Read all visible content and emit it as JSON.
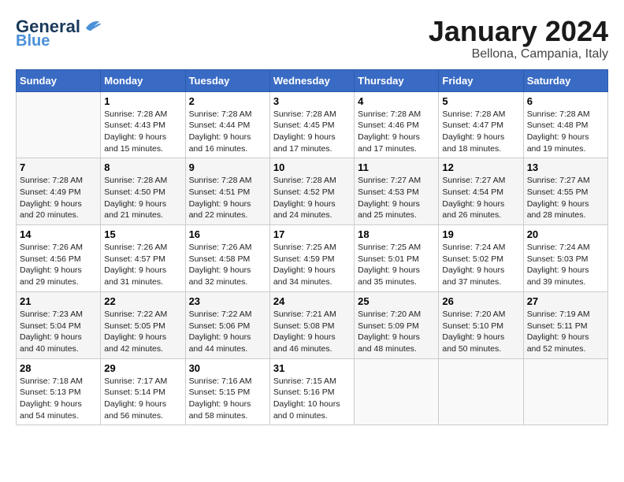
{
  "header": {
    "logo_general": "General",
    "logo_blue": "Blue",
    "month": "January 2024",
    "location": "Bellona, Campania, Italy"
  },
  "weekdays": [
    "Sunday",
    "Monday",
    "Tuesday",
    "Wednesday",
    "Thursday",
    "Friday",
    "Saturday"
  ],
  "weeks": [
    [
      {
        "day": "",
        "sunrise": "",
        "sunset": "",
        "daylight": ""
      },
      {
        "day": "1",
        "sunrise": "Sunrise: 7:28 AM",
        "sunset": "Sunset: 4:43 PM",
        "daylight": "Daylight: 9 hours and 15 minutes."
      },
      {
        "day": "2",
        "sunrise": "Sunrise: 7:28 AM",
        "sunset": "Sunset: 4:44 PM",
        "daylight": "Daylight: 9 hours and 16 minutes."
      },
      {
        "day": "3",
        "sunrise": "Sunrise: 7:28 AM",
        "sunset": "Sunset: 4:45 PM",
        "daylight": "Daylight: 9 hours and 17 minutes."
      },
      {
        "day": "4",
        "sunrise": "Sunrise: 7:28 AM",
        "sunset": "Sunset: 4:46 PM",
        "daylight": "Daylight: 9 hours and 17 minutes."
      },
      {
        "day": "5",
        "sunrise": "Sunrise: 7:28 AM",
        "sunset": "Sunset: 4:47 PM",
        "daylight": "Daylight: 9 hours and 18 minutes."
      },
      {
        "day": "6",
        "sunrise": "Sunrise: 7:28 AM",
        "sunset": "Sunset: 4:48 PM",
        "daylight": "Daylight: 9 hours and 19 minutes."
      }
    ],
    [
      {
        "day": "7",
        "sunrise": "Sunrise: 7:28 AM",
        "sunset": "Sunset: 4:49 PM",
        "daylight": "Daylight: 9 hours and 20 minutes."
      },
      {
        "day": "8",
        "sunrise": "Sunrise: 7:28 AM",
        "sunset": "Sunset: 4:50 PM",
        "daylight": "Daylight: 9 hours and 21 minutes."
      },
      {
        "day": "9",
        "sunrise": "Sunrise: 7:28 AM",
        "sunset": "Sunset: 4:51 PM",
        "daylight": "Daylight: 9 hours and 22 minutes."
      },
      {
        "day": "10",
        "sunrise": "Sunrise: 7:28 AM",
        "sunset": "Sunset: 4:52 PM",
        "daylight": "Daylight: 9 hours and 24 minutes."
      },
      {
        "day": "11",
        "sunrise": "Sunrise: 7:27 AM",
        "sunset": "Sunset: 4:53 PM",
        "daylight": "Daylight: 9 hours and 25 minutes."
      },
      {
        "day": "12",
        "sunrise": "Sunrise: 7:27 AM",
        "sunset": "Sunset: 4:54 PM",
        "daylight": "Daylight: 9 hours and 26 minutes."
      },
      {
        "day": "13",
        "sunrise": "Sunrise: 7:27 AM",
        "sunset": "Sunset: 4:55 PM",
        "daylight": "Daylight: 9 hours and 28 minutes."
      }
    ],
    [
      {
        "day": "14",
        "sunrise": "Sunrise: 7:26 AM",
        "sunset": "Sunset: 4:56 PM",
        "daylight": "Daylight: 9 hours and 29 minutes."
      },
      {
        "day": "15",
        "sunrise": "Sunrise: 7:26 AM",
        "sunset": "Sunset: 4:57 PM",
        "daylight": "Daylight: 9 hours and 31 minutes."
      },
      {
        "day": "16",
        "sunrise": "Sunrise: 7:26 AM",
        "sunset": "Sunset: 4:58 PM",
        "daylight": "Daylight: 9 hours and 32 minutes."
      },
      {
        "day": "17",
        "sunrise": "Sunrise: 7:25 AM",
        "sunset": "Sunset: 4:59 PM",
        "daylight": "Daylight: 9 hours and 34 minutes."
      },
      {
        "day": "18",
        "sunrise": "Sunrise: 7:25 AM",
        "sunset": "Sunset: 5:01 PM",
        "daylight": "Daylight: 9 hours and 35 minutes."
      },
      {
        "day": "19",
        "sunrise": "Sunrise: 7:24 AM",
        "sunset": "Sunset: 5:02 PM",
        "daylight": "Daylight: 9 hours and 37 minutes."
      },
      {
        "day": "20",
        "sunrise": "Sunrise: 7:24 AM",
        "sunset": "Sunset: 5:03 PM",
        "daylight": "Daylight: 9 hours and 39 minutes."
      }
    ],
    [
      {
        "day": "21",
        "sunrise": "Sunrise: 7:23 AM",
        "sunset": "Sunset: 5:04 PM",
        "daylight": "Daylight: 9 hours and 40 minutes."
      },
      {
        "day": "22",
        "sunrise": "Sunrise: 7:22 AM",
        "sunset": "Sunset: 5:05 PM",
        "daylight": "Daylight: 9 hours and 42 minutes."
      },
      {
        "day": "23",
        "sunrise": "Sunrise: 7:22 AM",
        "sunset": "Sunset: 5:06 PM",
        "daylight": "Daylight: 9 hours and 44 minutes."
      },
      {
        "day": "24",
        "sunrise": "Sunrise: 7:21 AM",
        "sunset": "Sunset: 5:08 PM",
        "daylight": "Daylight: 9 hours and 46 minutes."
      },
      {
        "day": "25",
        "sunrise": "Sunrise: 7:20 AM",
        "sunset": "Sunset: 5:09 PM",
        "daylight": "Daylight: 9 hours and 48 minutes."
      },
      {
        "day": "26",
        "sunrise": "Sunrise: 7:20 AM",
        "sunset": "Sunset: 5:10 PM",
        "daylight": "Daylight: 9 hours and 50 minutes."
      },
      {
        "day": "27",
        "sunrise": "Sunrise: 7:19 AM",
        "sunset": "Sunset: 5:11 PM",
        "daylight": "Daylight: 9 hours and 52 minutes."
      }
    ],
    [
      {
        "day": "28",
        "sunrise": "Sunrise: 7:18 AM",
        "sunset": "Sunset: 5:13 PM",
        "daylight": "Daylight: 9 hours and 54 minutes."
      },
      {
        "day": "29",
        "sunrise": "Sunrise: 7:17 AM",
        "sunset": "Sunset: 5:14 PM",
        "daylight": "Daylight: 9 hours and 56 minutes."
      },
      {
        "day": "30",
        "sunrise": "Sunrise: 7:16 AM",
        "sunset": "Sunset: 5:15 PM",
        "daylight": "Daylight: 9 hours and 58 minutes."
      },
      {
        "day": "31",
        "sunrise": "Sunrise: 7:15 AM",
        "sunset": "Sunset: 5:16 PM",
        "daylight": "Daylight: 10 hours and 0 minutes."
      },
      {
        "day": "",
        "sunrise": "",
        "sunset": "",
        "daylight": ""
      },
      {
        "day": "",
        "sunrise": "",
        "sunset": "",
        "daylight": ""
      },
      {
        "day": "",
        "sunrise": "",
        "sunset": "",
        "daylight": ""
      }
    ]
  ]
}
